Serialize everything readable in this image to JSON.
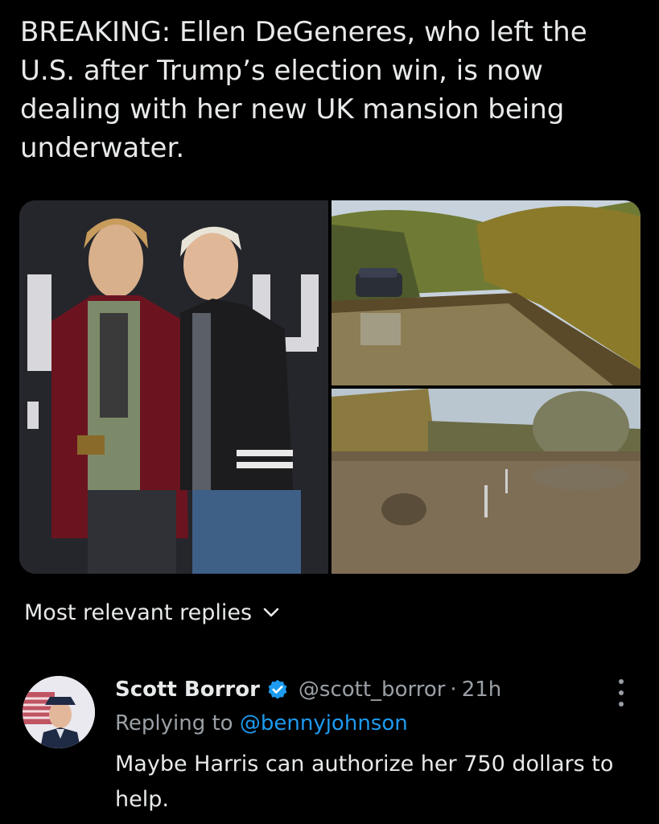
{
  "post": {
    "text": "BREAKING: Ellen DeGeneres, who left the U.S. after Trump’s election win, is now dealing with her new UK mansion being underwater."
  },
  "media": {
    "photos": [
      {
        "name": "couple-red-carpet-photo"
      },
      {
        "name": "flooded-road-car-photo"
      },
      {
        "name": "flooded-field-photo"
      }
    ]
  },
  "replies_sort": {
    "label": "Most relevant replies",
    "icon": "chevron-down-icon"
  },
  "reply": {
    "display_name": "Scott Borror",
    "handle": "@scott_borror",
    "separator": "·",
    "time": "21h",
    "replying_prefix": "Replying to",
    "replying_to": "@bennyjohnson",
    "text": "Maybe Harris can authorize her 750 dollars to help.",
    "verified_icon": "verified-badge-icon",
    "more_icon": "more-vertical-icon"
  },
  "colors": {
    "background": "#000000",
    "text": "#e7e9ea",
    "secondary": "#9aa0a6",
    "link": "#1d9bf0"
  }
}
